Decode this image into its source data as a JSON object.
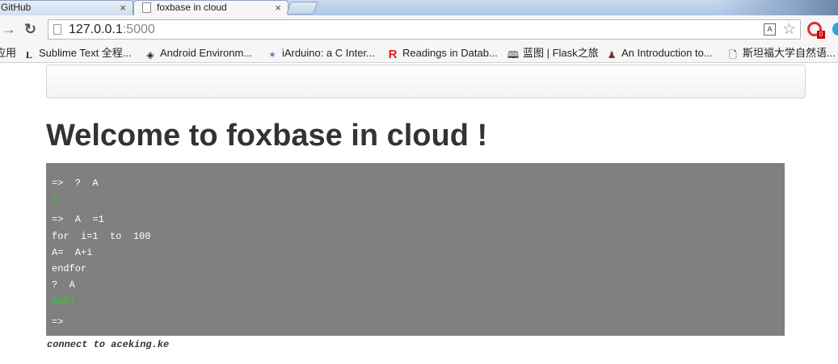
{
  "browser": {
    "tabs": [
      {
        "label": "GitHub",
        "active": false
      },
      {
        "label": "foxbase in cloud",
        "active": true
      }
    ],
    "close_glyph": "×",
    "url_host": "127.0.0.1",
    "url_port": ":5000",
    "bookmarks": [
      {
        "label": "应用",
        "icon": "apps-icon"
      },
      {
        "label": "Sublime Text 全程...",
        "icon": "sublime-icon"
      },
      {
        "label": "Android Environm...",
        "icon": "android-icon"
      },
      {
        "label": "iArduino: a C Inter...",
        "icon": "arduino-icon"
      },
      {
        "label": "Readings in Datab...",
        "icon": "readings-icon"
      },
      {
        "label": "蓝图 | Flask之旅",
        "icon": "book-icon"
      },
      {
        "label": "An Introduction to...",
        "icon": "person-icon"
      },
      {
        "label": "斯坦福大学自然语...",
        "icon": "page-icon"
      }
    ],
    "ext_badge": "0"
  },
  "page": {
    "title": "Welcome to foxbase in cloud !",
    "console_lines": [
      {
        "text": "=>  ?  A",
        "type": "input"
      },
      {
        "text": "1",
        "type": "output"
      },
      {
        "text": "=>  A  =1",
        "type": "input"
      },
      {
        "text": "for  i=1  to  100",
        "type": "input"
      },
      {
        "text": "A=  A+i",
        "type": "input"
      },
      {
        "text": "endfor",
        "type": "input"
      },
      {
        "text": "?  A",
        "type": "input"
      },
      {
        "text": "5051",
        "type": "output"
      },
      {
        "text": "=>",
        "type": "prompt"
      }
    ],
    "footer": "connect to aceking.ke"
  },
  "colors": {
    "console_bg": "#808080",
    "console_text": "#ffffff",
    "console_output": "#36c636",
    "heading": "#333333"
  }
}
